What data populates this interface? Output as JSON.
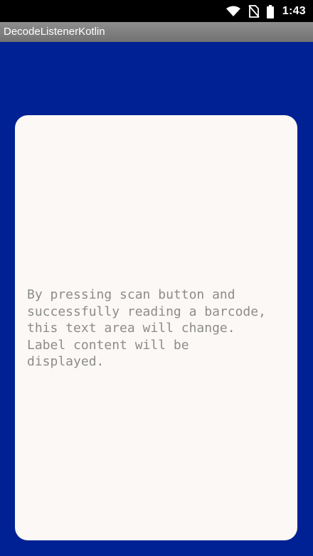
{
  "status_bar": {
    "time": "1:43",
    "icons": [
      "wifi-icon",
      "no-sim-icon",
      "battery-icon"
    ]
  },
  "app_bar": {
    "title": "DecodeListenerKotlin"
  },
  "card": {
    "text": "By pressing scan button and\nsuccessfully reading a barcode,\nthis text area will change.\nLabel content will be\ndisplayed."
  },
  "colors": {
    "background": "#002193",
    "card": "#fcf8f5",
    "card_text": "#8c8c8c",
    "app_bar": "#7f7f7f",
    "status_bar": "#000000"
  }
}
